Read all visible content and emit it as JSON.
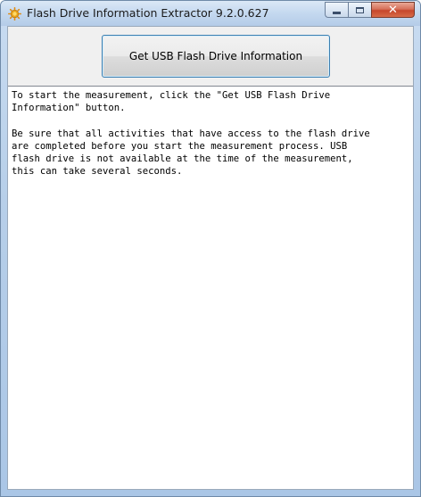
{
  "window": {
    "title": "Flash Drive Information Extractor 9.2.0.627",
    "app_icon": "sun-gear-icon",
    "caption": {
      "minimize_icon": "minimize-icon",
      "maximize_icon": "maximize-icon",
      "close_icon": "close-icon",
      "close_glyph": "✕"
    }
  },
  "toolbar": {
    "get_info_label": "Get USB Flash Drive Information"
  },
  "output": {
    "line_1": "To start the measurement, click the \"Get USB Flash Drive\nInformation\" button.",
    "line_2": "Be sure that all activities that have access to the flash drive\nare completed before you start the measurement process. USB\nflash drive is not available at the time of the measurement,\nthis can take several seconds."
  },
  "colors": {
    "button_border": "#3c7fb1",
    "close_button": "#c6462c",
    "titlebar": "#c4d8ef"
  }
}
